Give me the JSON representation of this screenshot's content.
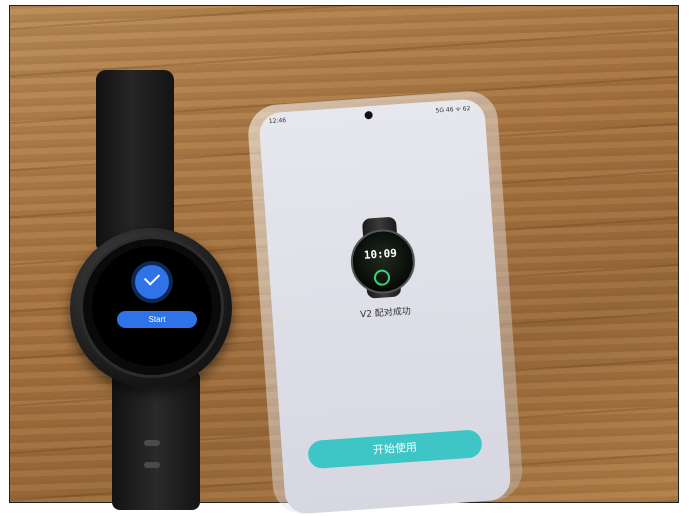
{
  "watch": {
    "start_label": "Start"
  },
  "phone": {
    "status_time": "12:46",
    "status_right": "5G 46 ᯤ 62",
    "mini_watch_time": "10:09",
    "pair_success_text": "V2 配对成功",
    "start_use_label": "开始使用"
  },
  "colors": {
    "watch_accent": "#2f73e8",
    "phone_button": "#3ec6c6"
  }
}
